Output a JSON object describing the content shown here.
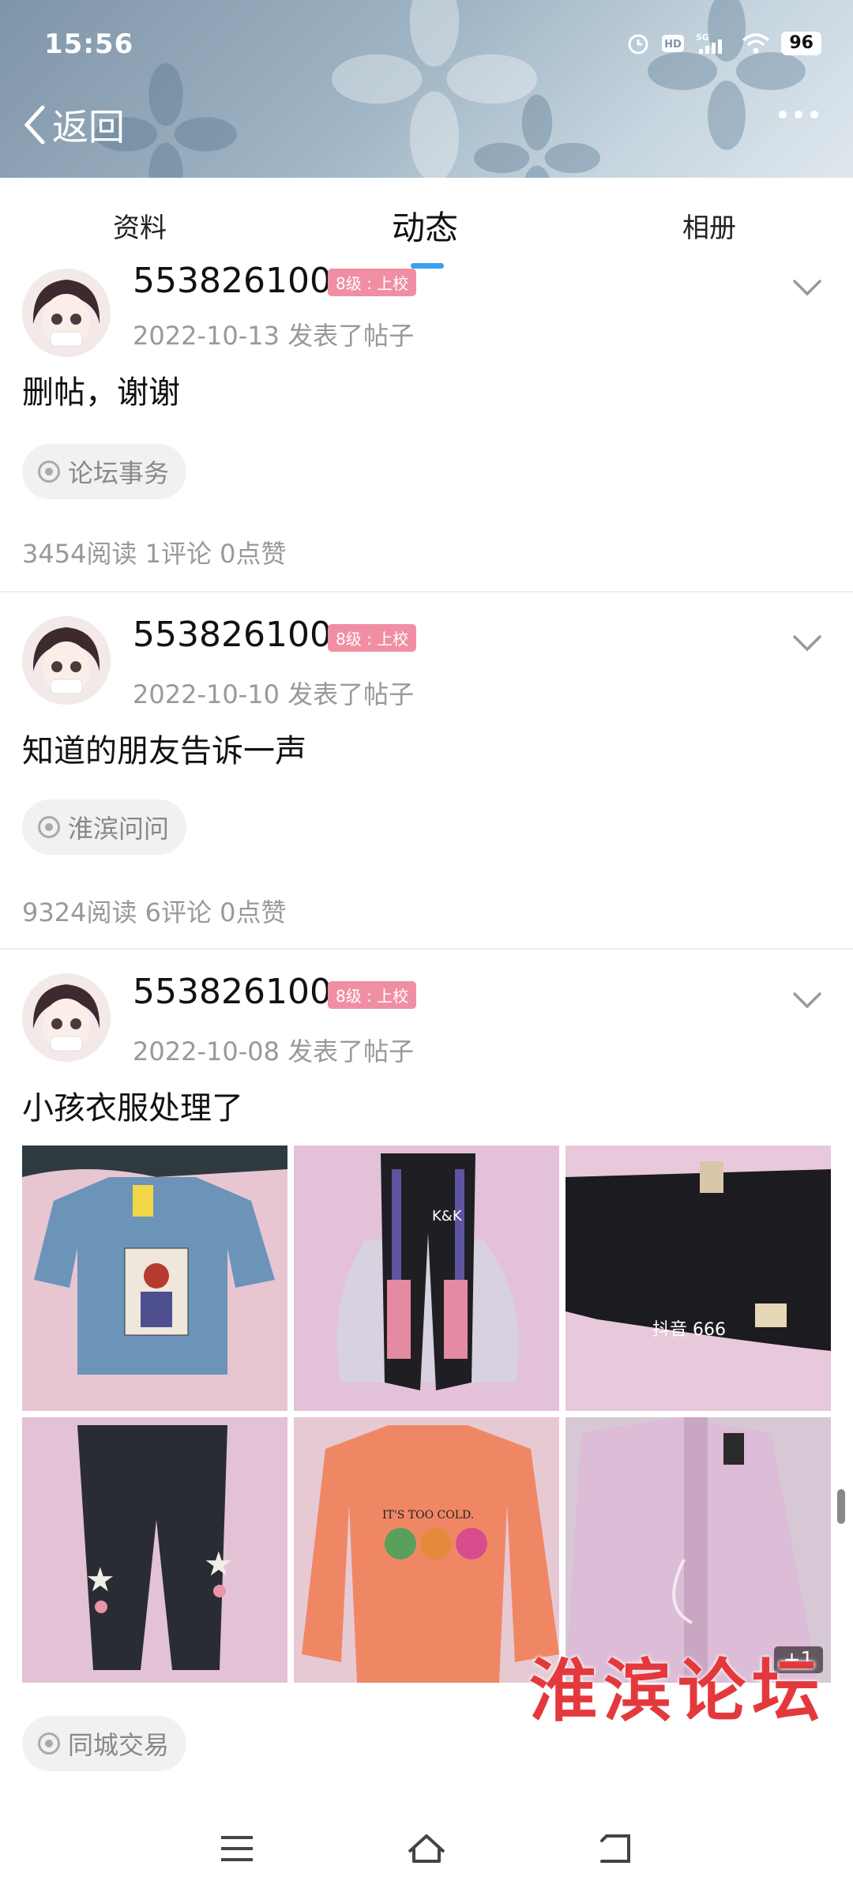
{
  "status_bar": {
    "time": "15:56",
    "icons": [
      "alarm-icon",
      "hd-icon",
      "signal-5g-icon",
      "wifi-icon"
    ],
    "battery": "96"
  },
  "header": {
    "back_label": "返回",
    "more_icon": "more-dots-icon"
  },
  "tabs": [
    {
      "label": "资料",
      "active": false
    },
    {
      "label": "动态",
      "active": true
    },
    {
      "label": "相册",
      "active": false
    }
  ],
  "posts": [
    {
      "username": "553826100",
      "level": "8级 : 上校",
      "meta": "2022-10-13  发表了帖子",
      "text": "删帖，谢谢",
      "tag": "论坛事务",
      "stats": "3454阅读 1评论 0点赞"
    },
    {
      "username": "553826100",
      "level": "8级 : 上校",
      "meta": "2022-10-10  发表了帖子",
      "text": "知道的朋友告诉一声",
      "tag": "淮滨问问",
      "stats": "9324阅读 6评论 0点赞"
    },
    {
      "username": "553826100",
      "level": "8级 : 上校",
      "meta": "2022-10-08  发表了帖子",
      "text": "小孩衣服处理了",
      "tag": "同城交易",
      "photos": [
        "blue-sweater",
        "black-pants-kk",
        "black-pants-douyin",
        "black-jeans-stars",
        "orange-sweatshirt",
        "pink-jacket"
      ],
      "photo_print_kk": "K&K",
      "photo_print_douyin": "抖音 666",
      "photo_print_tshirt": "IT'S TOO COLD.",
      "extra_count": "+1"
    }
  ],
  "watermark": "淮滨论坛",
  "nav": [
    "menu-icon",
    "home-icon",
    "back-icon"
  ],
  "colors": {
    "accent": "#3aa0f0",
    "badge": "#f08fa3",
    "watermark": "#e4393c"
  }
}
